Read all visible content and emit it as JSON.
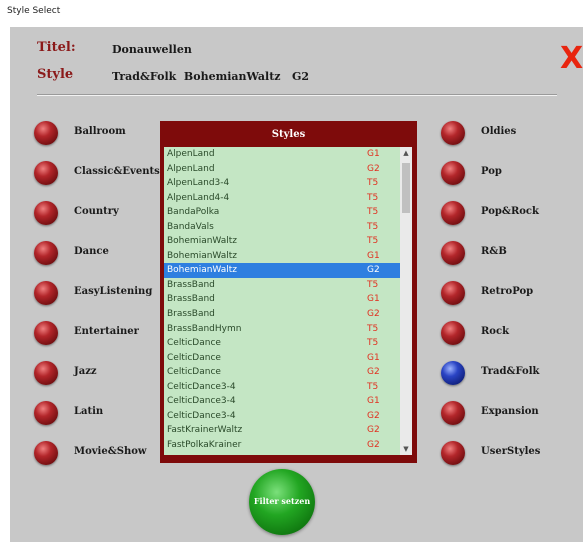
{
  "window": {
    "title": "Style Select"
  },
  "header": {
    "titel_label": "Titel:",
    "titel_value": "Donauwellen",
    "style_label": "Style",
    "style_value": "Trad&Folk  BohemianWaltz   G2"
  },
  "close_label": "X",
  "left_categories": [
    "Ballroom",
    "Classic&Events",
    "Country",
    "Dance",
    "EasyListening",
    "Entertainer",
    "Jazz",
    "Latin",
    "Movie&Show"
  ],
  "right_categories": [
    "Oldies",
    "Pop",
    "Pop&Rock",
    "R&B",
    "RetroPop",
    "Rock",
    "Trad&Folk",
    "Expansion",
    "UserStyles"
  ],
  "active_category": "Trad&Folk",
  "styles_panel": {
    "title": "Styles",
    "items": [
      {
        "name": "AlpenLand",
        "type": "G1"
      },
      {
        "name": "AlpenLand",
        "type": "G2"
      },
      {
        "name": "AlpenLand3-4",
        "type": "T5"
      },
      {
        "name": "AlpenLand4-4",
        "type": "T5"
      },
      {
        "name": "BandaPolka",
        "type": "T5"
      },
      {
        "name": "BandaVals",
        "type": "T5"
      },
      {
        "name": "BohemianWaltz",
        "type": "T5"
      },
      {
        "name": "BohemianWaltz",
        "type": "G1"
      },
      {
        "name": "BohemianWaltz",
        "type": "G2"
      },
      {
        "name": "BrassBand",
        "type": "T5"
      },
      {
        "name": "BrassBand",
        "type": "G1"
      },
      {
        "name": "BrassBand",
        "type": "G2"
      },
      {
        "name": "BrassBandHymn",
        "type": "T5"
      },
      {
        "name": "CelticDance",
        "type": "T5"
      },
      {
        "name": "CelticDance",
        "type": "G1"
      },
      {
        "name": "CelticDance",
        "type": "G2"
      },
      {
        "name": "CelticDance3-4",
        "type": "T5"
      },
      {
        "name": "CelticDance3-4",
        "type": "G1"
      },
      {
        "name": "CelticDance3-4",
        "type": "G2"
      },
      {
        "name": "FastKrainerWaltz",
        "type": "G2"
      },
      {
        "name": "FastPolkaKrainer",
        "type": "G2"
      }
    ],
    "selected_index": 8
  },
  "scroll": {
    "up": "▲",
    "down": "▼"
  },
  "filter_button": {
    "label": "Filter setzen"
  },
  "colors": {
    "accent_red": "#8b1a1a",
    "close_red": "#e8250f",
    "list_bg": "#c4e6c4",
    "selection_blue": "#2e7fe0",
    "filter_green": "#22a622"
  }
}
